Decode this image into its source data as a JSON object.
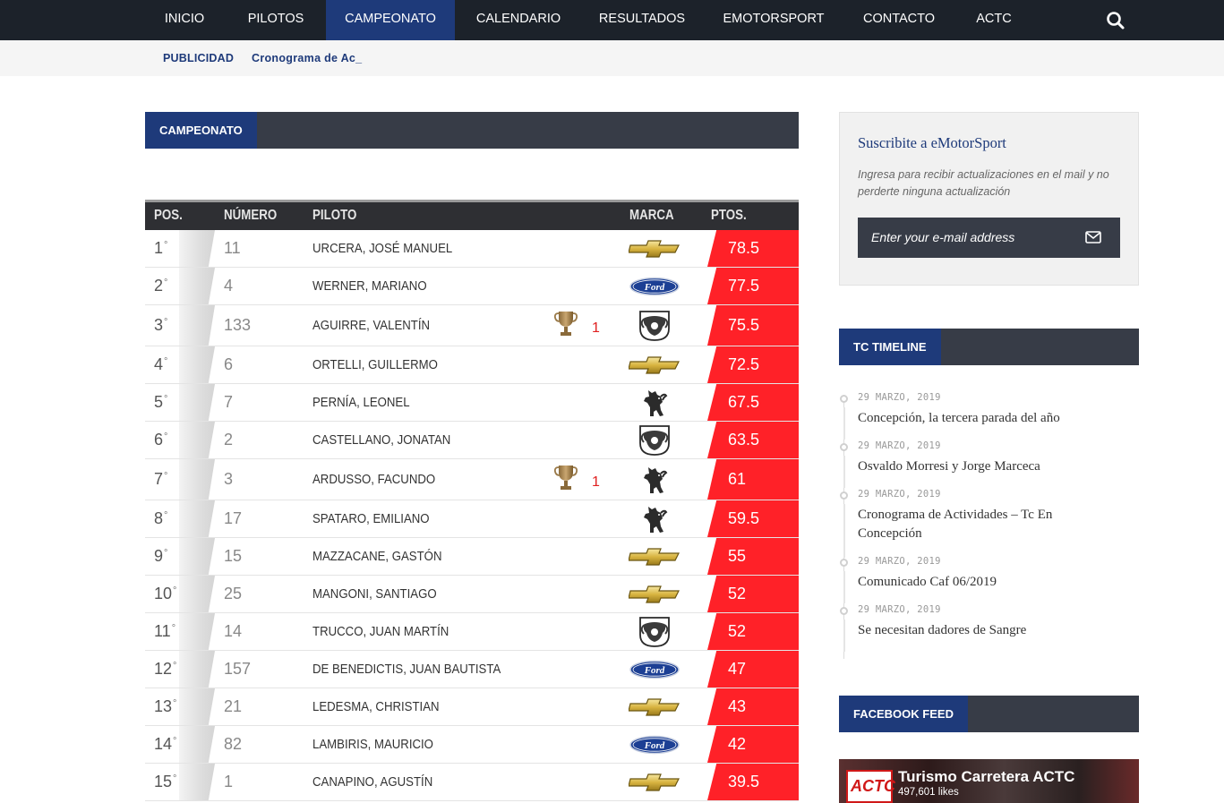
{
  "nav": {
    "items": [
      {
        "label": "INICIO",
        "active": false
      },
      {
        "label": "PILOTOS",
        "active": false
      },
      {
        "label": "CAMPEONATO",
        "active": true
      },
      {
        "label": "CALENDARIO",
        "active": false
      },
      {
        "label": "RESULTADOS",
        "active": false
      },
      {
        "label": "EMOTORSPORT",
        "active": false
      },
      {
        "label": "CONTACTO",
        "active": false
      },
      {
        "label": "ACTC",
        "active": false
      }
    ],
    "search_icon": "search-icon"
  },
  "subbar": {
    "label": "PUBLICIDAD",
    "ticker": "Cronograma de Ac_"
  },
  "main": {
    "section_title": "CAMPEONATO"
  },
  "standings": {
    "headers": {
      "pos": "POS.",
      "number": "NÚMERO",
      "driver": "PILOTO",
      "brand": "MARCA",
      "points": "PTOS."
    },
    "rows": [
      {
        "pos": "1",
        "number": "11",
        "driver": "URCERA, JOSÉ MANUEL",
        "brand": "chevrolet",
        "points": "78.5",
        "wins": null
      },
      {
        "pos": "2",
        "number": "4",
        "driver": "WERNER, MARIANO",
        "brand": "ford",
        "points": "77.5",
        "wins": null
      },
      {
        "pos": "3",
        "number": "133",
        "driver": "AGUIRRE, VALENTÍN",
        "brand": "dodge",
        "points": "75.5",
        "wins": "1"
      },
      {
        "pos": "4",
        "number": "6",
        "driver": "ORTELLI, GUILLERMO",
        "brand": "chevrolet",
        "points": "72.5",
        "wins": null
      },
      {
        "pos": "5",
        "number": "7",
        "driver": "PERNÍA, LEONEL",
        "brand": "torino",
        "points": "67.5",
        "wins": null
      },
      {
        "pos": "6",
        "number": "2",
        "driver": "CASTELLANO, JONATAN",
        "brand": "dodge",
        "points": "63.5",
        "wins": null
      },
      {
        "pos": "7",
        "number": "3",
        "driver": "ARDUSSO, FACUNDO",
        "brand": "torino",
        "points": "61",
        "wins": "1"
      },
      {
        "pos": "8",
        "number": "17",
        "driver": "SPATARO, EMILIANO",
        "brand": "torino",
        "points": "59.5",
        "wins": null
      },
      {
        "pos": "9",
        "number": "15",
        "driver": "MAZZACANE, GASTÓN",
        "brand": "chevrolet",
        "points": "55",
        "wins": null
      },
      {
        "pos": "10",
        "number": "25",
        "driver": "MANGONI, SANTIAGO",
        "brand": "chevrolet",
        "points": "52",
        "wins": null
      },
      {
        "pos": "11",
        "number": "14",
        "driver": "TRUCCO, JUAN MARTÍN",
        "brand": "dodge",
        "points": "52",
        "wins": null
      },
      {
        "pos": "12",
        "number": "157",
        "driver": "DE BENEDICTIS, JUAN BAUTISTA",
        "brand": "ford",
        "points": "47",
        "wins": null
      },
      {
        "pos": "13",
        "number": "21",
        "driver": "LEDESMA, CHRISTIAN",
        "brand": "chevrolet",
        "points": "43",
        "wins": null
      },
      {
        "pos": "14",
        "number": "82",
        "driver": "LAMBIRIS, MAURICIO",
        "brand": "ford",
        "points": "42",
        "wins": null
      },
      {
        "pos": "15",
        "number": "1",
        "driver": "CANAPINO, AGUSTÍN",
        "brand": "chevrolet",
        "points": "39.5",
        "wins": null
      }
    ],
    "pos_suffix": "°",
    "trophy_icon": "trophy-icon"
  },
  "sidebar": {
    "subscribe": {
      "title": "Suscribite a eMotorSport",
      "description": "Ingresa para recibir actualizaciones en el mail y no perderte ninguna actualización",
      "placeholder": "Enter your e-mail address",
      "icon": "envelope-icon"
    },
    "timeline": {
      "title": "TC TIMELINE",
      "items": [
        {
          "date": "29 MARZO, 2019",
          "title": "Concepción, la tercera parada del año"
        },
        {
          "date": "29 MARZO, 2019",
          "title": "Osvaldo Morresi y Jorge Marceca"
        },
        {
          "date": "29 MARZO, 2019",
          "title": "Cronograma de Actividades – Tc En Concepción"
        },
        {
          "date": "29 MARZO, 2019",
          "title": "Comunicado Caf 06/2019"
        },
        {
          "date": "29 MARZO, 2019",
          "title": "Se necesitan dadores de Sangre"
        }
      ]
    },
    "facebook": {
      "title": "FACEBOOK FEED",
      "page_name": "Turismo Carretera ACTC",
      "likes": "497,601 likes",
      "logo_text": "ACTC"
    }
  },
  "colors": {
    "nav_bg": "#1c222a",
    "accent_blue": "#1e3a7a",
    "points_red": "#ff2128",
    "header_dark": "#373c47"
  }
}
